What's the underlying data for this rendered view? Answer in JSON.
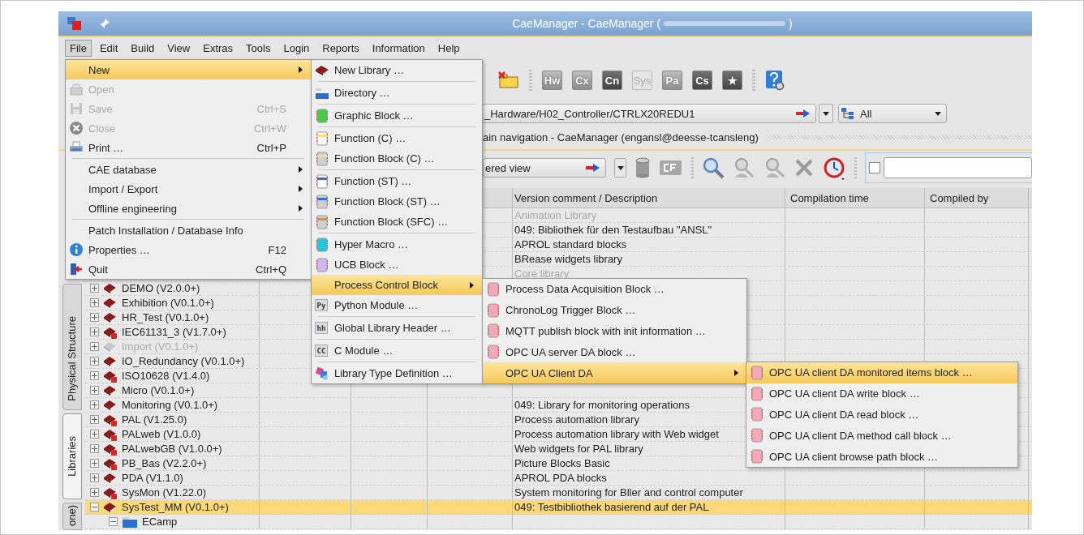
{
  "window": {
    "title": "CaeManager - CaeManager (",
    "title_end": ")"
  },
  "menubar": [
    {
      "label": "File",
      "selected": true
    },
    {
      "label": "Edit",
      "selected": false
    },
    {
      "label": "Build",
      "selected": false
    },
    {
      "label": "View",
      "selected": false
    },
    {
      "label": "Extras",
      "selected": false
    },
    {
      "label": "Tools",
      "selected": false
    },
    {
      "label": "Login",
      "selected": false
    },
    {
      "label": "Reports",
      "selected": false
    },
    {
      "label": "Information",
      "selected": false
    },
    {
      "label": "Help",
      "selected": false
    }
  ],
  "toolbar": [
    {
      "kind": "folder-x"
    },
    {
      "kind": "grip"
    },
    {
      "kind": "tag",
      "label": "Hw",
      "selected": false,
      "disabled": false
    },
    {
      "kind": "tag",
      "label": "Cx",
      "selected": false,
      "disabled": false
    },
    {
      "kind": "tag",
      "label": "Cn",
      "selected": true,
      "disabled": false
    },
    {
      "kind": "tag",
      "label": "Sys",
      "selected": false,
      "disabled": true
    },
    {
      "kind": "tag",
      "label": "Pa",
      "selected": false,
      "disabled": false
    },
    {
      "kind": "tag",
      "label": "Cs",
      "selected": true,
      "disabled": false
    },
    {
      "kind": "tag",
      "label": "★",
      "selected": true,
      "disabled": false
    },
    {
      "kind": "grip"
    },
    {
      "kind": "help"
    }
  ],
  "path_bar": {
    "path": "_Hardware/H02_Controller/CTRLX20REDU1",
    "filter": "All"
  },
  "navigation": {
    "title": "ain navigation - CaeManager (engansl@deesse-tcansleng)"
  },
  "view_bar": {
    "view": "ered view",
    "search": {
      "checked": false
    }
  },
  "side_tabs": [
    {
      "label": "Physical Structure",
      "selected": false
    },
    {
      "label": "Libraries",
      "selected": true
    },
    {
      "label": "one)",
      "selected": false
    }
  ],
  "table": {
    "columns": [
      "Version comment / Description",
      "Compilation time",
      "Compiled by"
    ],
    "rows": [
      {
        "description": "Animation Library",
        "disabled": true,
        "selected": false
      },
      {
        "description": "049: Bibliothek für den Testaufbau \"ANSL\"",
        "disabled": false,
        "selected": false
      },
      {
        "description": "APROL standard blocks",
        "disabled": false,
        "selected": false
      },
      {
        "description": "BRease widgets library",
        "disabled": false,
        "selected": false
      },
      {
        "description": "Core library",
        "disabled": true,
        "selected": false
      },
      {
        "kind": "library",
        "name": "DEMO (V2.0.0+)",
        "expanded": false,
        "locked": false,
        "disabled": false,
        "selected": false
      },
      {
        "kind": "library",
        "name": "Exhibition (V0.1.0+)",
        "expanded": false,
        "locked": false,
        "disabled": false,
        "selected": false
      },
      {
        "kind": "library",
        "name": "HR_Test (V0.1.0+)",
        "expanded": false,
        "locked": false,
        "disabled": false,
        "selected": false
      },
      {
        "kind": "library",
        "name": "IEC61131_3 (V1.7.0+)",
        "expanded": false,
        "locked": true,
        "disabled": false,
        "selected": false
      },
      {
        "kind": "library",
        "name": "Import (V0.1.0+)",
        "expanded": false,
        "locked": false,
        "disabled": true,
        "selected": false
      },
      {
        "kind": "library",
        "name": "IO_Redundancy (V0.1.0+)",
        "expanded": false,
        "locked": false,
        "disabled": false,
        "selected": false
      },
      {
        "kind": "library",
        "name": "ISO10628 (V1.4.0)",
        "expanded": false,
        "locked": true,
        "disabled": false,
        "selected": false
      },
      {
        "kind": "library",
        "name": "Micro (V0.1.0+)",
        "expanded": false,
        "locked": false,
        "disabled": false,
        "selected": false
      },
      {
        "kind": "library",
        "name": "Monitoring (V0.1.0+)",
        "description": "049: Library for monitoring operations",
        "expanded": false,
        "locked": false,
        "disabled": false,
        "selected": false
      },
      {
        "kind": "library",
        "name": "PAL (V1.25.0)",
        "description": "Process automation library",
        "expanded": false,
        "locked": true,
        "disabled": false,
        "selected": false
      },
      {
        "kind": "library",
        "name": "PALweb (V1.0.0)",
        "description": "Process automation library with Web widget",
        "expanded": false,
        "locked": true,
        "disabled": false,
        "selected": false
      },
      {
        "kind": "library",
        "name": "PALwebGB (V1.0.0+)",
        "description": "Web widgets for PAL library",
        "expanded": false,
        "locked": true,
        "disabled": false,
        "selected": false
      },
      {
        "kind": "library",
        "name": "PB_Bas (V2.2.0+)",
        "description": "Picture Blocks Basic",
        "expanded": false,
        "locked": true,
        "disabled": false,
        "selected": false
      },
      {
        "kind": "library",
        "name": "PDA (V1.1.0)",
        "description": "APROL PDA blocks",
        "expanded": false,
        "locked": false,
        "disabled": false,
        "selected": false
      },
      {
        "kind": "library",
        "name": "SysMon (V1.22.0)",
        "description": "System monitoring for Bller and control computer",
        "expanded": false,
        "locked": true,
        "disabled": false,
        "selected": false
      },
      {
        "kind": "library",
        "name": "SysTest_MM (V0.1.0+)",
        "description": "049: Testbibliothek  basierend auf der PAL",
        "expanded": true,
        "locked": false,
        "disabled": false,
        "selected": true,
        "children": [
          {
            "kind": "directory",
            "name": "ECamp",
            "expanded": true,
            "disabled": false,
            "selected": false
          }
        ]
      }
    ]
  },
  "menus": [
    {
      "items": [
        {
          "label": "New",
          "submenu": true,
          "selected": true,
          "disabled": false
        },
        {
          "label": "Open",
          "submenu": false,
          "selected": false,
          "disabled": true
        },
        {
          "label": "Save",
          "shortcut": "Ctrl+S",
          "submenu": false,
          "selected": false,
          "disabled": true
        },
        {
          "label": "Close",
          "shortcut": "Ctrl+W",
          "submenu": false,
          "selected": false,
          "disabled": true
        },
        {
          "label": "Print …",
          "shortcut": "Ctrl+P",
          "submenu": false,
          "selected": false,
          "disabled": false
        },
        {
          "kind": "separator"
        },
        {
          "label": "CAE database",
          "submenu": true,
          "selected": false,
          "disabled": false
        },
        {
          "label": "Import / Export",
          "submenu": true,
          "selected": false,
          "disabled": false
        },
        {
          "label": "Offline engineering",
          "submenu": true,
          "selected": false,
          "disabled": false
        },
        {
          "kind": "separator"
        },
        {
          "label": "Patch Installation / Database Info",
          "submenu": false,
          "selected": false,
          "disabled": false
        },
        {
          "label": "Properties …",
          "shortcut": "F12",
          "submenu": false,
          "selected": false,
          "disabled": false
        },
        {
          "label": "Quit",
          "shortcut": "Ctrl+Q",
          "submenu": false,
          "selected": false,
          "disabled": false
        }
      ]
    },
    {
      "items": [
        {
          "label": "New Library …",
          "submenu": false,
          "selected": false
        },
        {
          "kind": "separator"
        },
        {
          "label": "Directory …",
          "submenu": false,
          "selected": false
        },
        {
          "kind": "separator"
        },
        {
          "label": "Graphic Block …",
          "color": "#44cc44",
          "submenu": false,
          "selected": false
        },
        {
          "kind": "separator"
        },
        {
          "label": "Function (C) …",
          "color": "#f5e27a",
          "submenu": false,
          "selected": false
        },
        {
          "label": "Function Block (C) …",
          "color": "#f5e27a",
          "submenu": false,
          "selected": false
        },
        {
          "kind": "separator"
        },
        {
          "label": "Function (ST) …",
          "color": "#2f6fd6",
          "submenu": false,
          "selected": false
        },
        {
          "label": "Function Block (ST) …",
          "color": "#2f6fd6",
          "submenu": false,
          "selected": false
        },
        {
          "label": "Function Block (SFC) …",
          "color": "#f08a1c",
          "submenu": false,
          "selected": false
        },
        {
          "kind": "separator"
        },
        {
          "label": "Hyper Macro …",
          "color": "#1ec8e0",
          "submenu": false,
          "selected": false
        },
        {
          "label": "UCB Block …",
          "color": "#cdb8f0",
          "submenu": false,
          "selected": false
        },
        {
          "label": "Process Control Block",
          "submenu": true,
          "selected": true
        },
        {
          "label": "Python Module …",
          "icon_text": "Py",
          "submenu": false,
          "selected": false
        },
        {
          "kind": "separator"
        },
        {
          "label": "Global Library Header …",
          "icon_text": "hh",
          "submenu": false,
          "selected": false
        },
        {
          "kind": "separator"
        },
        {
          "label": "C Module …",
          "icon_text": "CC",
          "submenu": false,
          "selected": false
        },
        {
          "kind": "separator"
        },
        {
          "label": "Library Type Definition …",
          "submenu": false,
          "selected": false
        }
      ]
    },
    {
      "items": [
        {
          "label": "Process Data Acquisition Block …",
          "color": "#f7a8b8",
          "submenu": false,
          "selected": false
        },
        {
          "label": "ChronoLog Trigger Block …",
          "color": "#f7a8b8",
          "submenu": false,
          "selected": false
        },
        {
          "label": "MQTT publish block with init information …",
          "color": "#f7a8b8",
          "submenu": false,
          "selected": false
        },
        {
          "label": "OPC UA server DA block …",
          "color": "#f7a8b8",
          "submenu": false,
          "selected": false
        },
        {
          "label": "OPC UA Client DA",
          "submenu": true,
          "selected": true
        }
      ]
    },
    {
      "items": [
        {
          "label": "OPC UA client DA monitored items block …",
          "color": "#f7a8b8",
          "submenu": false,
          "selected": true
        },
        {
          "label": "OPC UA client DA write block …",
          "color": "#f7a8b8",
          "submenu": false,
          "selected": false
        },
        {
          "label": "OPC UA client DA read block …",
          "color": "#f7a8b8",
          "submenu": false,
          "selected": false
        },
        {
          "label": "OPC UA client DA method call block …",
          "color": "#f7a8b8",
          "submenu": false,
          "selected": false
        },
        {
          "label": "OPC UA client browse path block …",
          "color": "#f7a8b8",
          "submenu": false,
          "selected": false
        }
      ]
    }
  ]
}
